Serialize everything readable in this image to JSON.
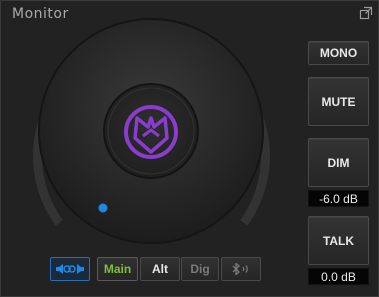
{
  "title": "Monitor",
  "icons": {
    "popout": "popout-icon",
    "logo": "purple-fox-logo-icon",
    "speaker": "speaker-link-icon",
    "bluetooth": "bluetooth-icon",
    "knob_indicator": "knob-position-dot"
  },
  "colors": {
    "accent": "#1e88e5",
    "logo": "#8a3ccf",
    "main_active": "#7fbf3a",
    "dim_text": "#7a7a7a"
  },
  "buttons": {
    "mono": "MONO",
    "mute": "MUTE",
    "dim": "DIM",
    "talk": "TALK"
  },
  "readouts": {
    "dim_level": "-6.0 dB",
    "talk_level": "0.0 dB"
  },
  "sources": {
    "main": "Main",
    "alt": "Alt",
    "dig": "Dig"
  }
}
